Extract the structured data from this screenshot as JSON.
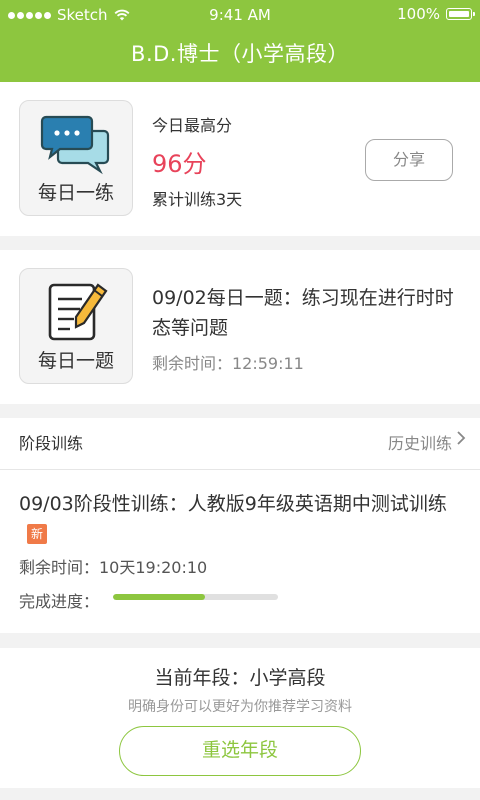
{
  "status_bar": {
    "carrier": "Sketch",
    "time": "9:41 AM",
    "battery": "100%"
  },
  "header": {
    "title": "B.D.博士（小学高段）"
  },
  "daily_practice": {
    "caption": "每日一练",
    "icon": "chat-bubbles-icon",
    "score_label": "今日最高分",
    "score": "96分",
    "streak": "累计训练3天",
    "share_label": "分享"
  },
  "daily_question": {
    "caption": "每日一题",
    "icon": "notepad-pencil-icon",
    "title": "09/02每日一题：练习现在进行时时态等问题",
    "remaining": "剩余时间：12:59:11"
  },
  "stage_training": {
    "heading": "阶段训练",
    "history_label": "历史训练",
    "title": "09/03阶段性训练：人教版9年级英语期中测试训练",
    "badge": "新",
    "remaining": "剩余时间：10天19:20:10",
    "progress_label": "完成进度：",
    "progress": 0.56
  },
  "grade": {
    "current": "当前年段：小学高段",
    "hint": "明确身份可以更好为你推荐学习资料",
    "reselect_label": "重选年段"
  },
  "colors": {
    "accent": "#8dc63f",
    "score": "#e8435a",
    "badge": "#f07a48"
  }
}
